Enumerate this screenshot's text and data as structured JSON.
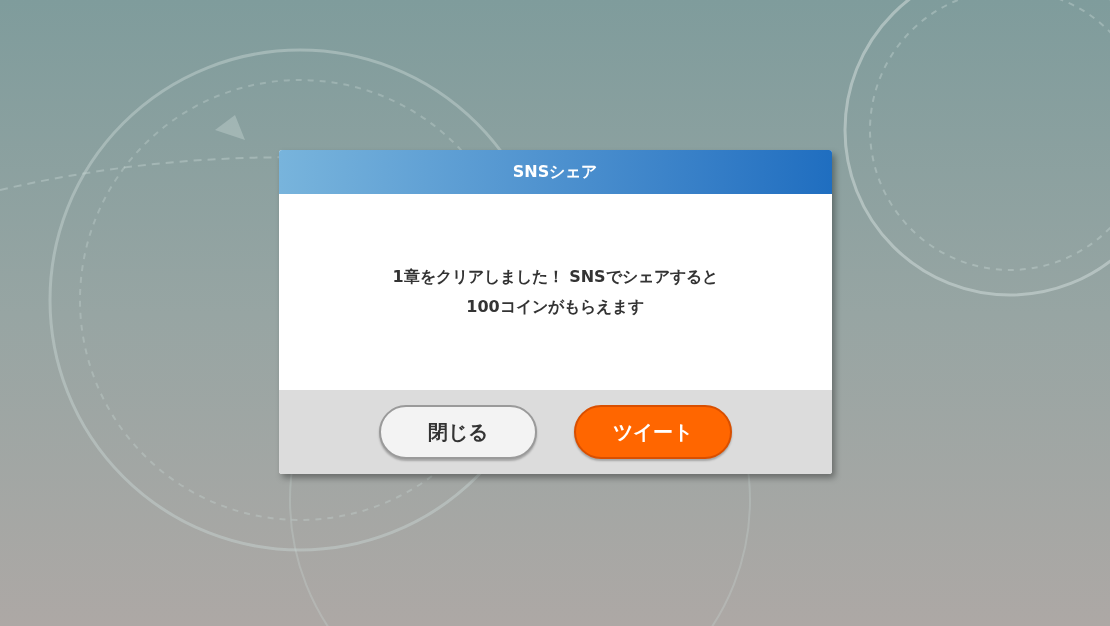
{
  "dialog": {
    "title": "SNSシェア",
    "message_lines": [
      "1章をクリアしました！ SNSでシェアすると",
      "100コインがもらえます"
    ],
    "buttons": [
      {
        "label": "閉じる",
        "kind": "secondary"
      },
      {
        "label": "ツイート",
        "kind": "primary"
      }
    ]
  }
}
